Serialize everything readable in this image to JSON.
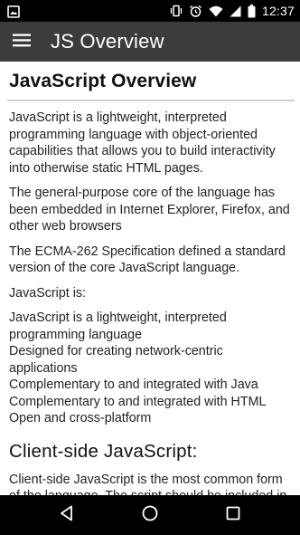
{
  "status_bar": {
    "time": "12:37",
    "icons": [
      "image-notification-icon",
      "vibrate-icon",
      "alarm-icon",
      "wifi-icon",
      "cellular-signal-icon",
      "battery-icon"
    ]
  },
  "app_bar": {
    "title": "JS Overview",
    "menu_icon": "hamburger-menu-icon",
    "background": "#3c3c3c"
  },
  "content": {
    "heading": "JavaScript Overview",
    "paragraphs": [
      "JavaScript is a lightweight, interpreted programming language with object-oriented capabilities that allows you to build interactivity into otherwise static HTML pages.",
      "The general-purpose core of the language has been embedded in Internet Explorer, Firefox, and other web browsers",
      "The ECMA-262 Specification defined a standard version of the core JavaScript language.",
      "JavaScript is:"
    ],
    "list_items": [
      "JavaScript is a lightweight, interpreted programming language",
      "Designed for creating network-centric applications",
      "Complementary to and integrated with Java",
      "Complementary to and integrated with HTML",
      "Open and cross-platform"
    ],
    "subheading": "Client-side JavaScript:",
    "client_side_paragraph": "Client-side JavaScript is the most common form of the language. The script should be included in"
  },
  "nav_bar": {
    "buttons": [
      "back-icon",
      "home-icon",
      "recents-icon"
    ]
  }
}
